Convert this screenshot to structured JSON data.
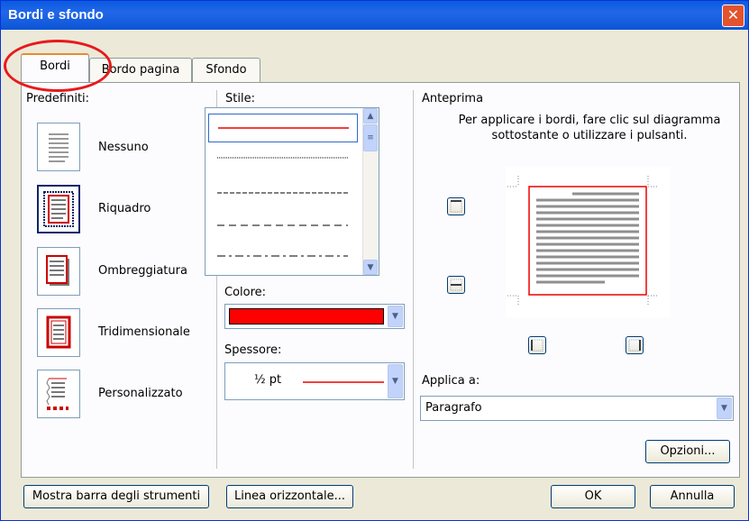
{
  "dialog": {
    "title": "Bordi e sfondo",
    "close_symbol": "✕"
  },
  "tabs": [
    {
      "label": "Bordi"
    },
    {
      "label": "Bordo pagina"
    },
    {
      "label": "Sfondo"
    }
  ],
  "presets": {
    "heading": "Predefiniti:",
    "items": [
      {
        "label": "Nessuno"
      },
      {
        "label": "Riquadro"
      },
      {
        "label": "Ombreggiatura"
      },
      {
        "label": "Tridimensionale"
      },
      {
        "label": "Personalizzato"
      }
    ],
    "selected": "Riquadro"
  },
  "style": {
    "heading": "Stile:",
    "options": [
      "solid",
      "dotted",
      "dashed-fine",
      "dashed",
      "dash-dot"
    ],
    "selected": "solid"
  },
  "color": {
    "heading": "Colore:",
    "value": "#ff0000"
  },
  "width": {
    "heading": "Spessore:",
    "value": "½ pt"
  },
  "preview": {
    "heading": "Anteprima",
    "instructions": "Per applicare i bordi, fare clic sul diagramma sottostante o utilizzare i pulsanti."
  },
  "apply_to": {
    "heading": "Applica a:",
    "value": "Paragrafo"
  },
  "buttons": {
    "options": "Opzioni...",
    "toolbar": "Mostra barra degli strumenti",
    "horizontal_line": "Linea orizzontale...",
    "ok": "OK",
    "cancel": "Annulla"
  },
  "colors": {
    "titlebar": "#0a5be0",
    "border_accent": "#e8191c",
    "face": "#ece9d8"
  }
}
